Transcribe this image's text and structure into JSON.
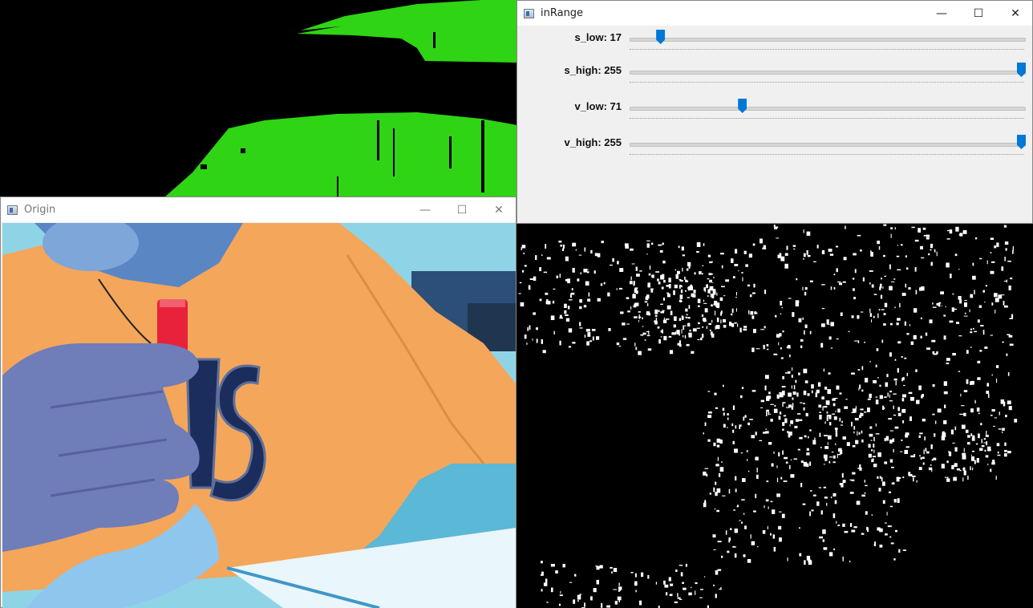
{
  "origin_window": {
    "title": "Origin",
    "minimize": "—",
    "maximize": "☐",
    "close": "✕"
  },
  "inrange_window": {
    "title": "inRange",
    "minimize": "—",
    "maximize": "☐",
    "close": "✕",
    "trackbars": [
      {
        "label": "s_low: 17",
        "value": 17,
        "max": 255
      },
      {
        "label": "s_high: 255",
        "value": 255,
        "max": 255
      },
      {
        "label": "v_low: 71",
        "value": 71,
        "max": 255
      },
      {
        "label": "v_high: 255",
        "value": 255,
        "max": 255
      }
    ]
  },
  "colors": {
    "mask_green": "#2fd414",
    "thumb_blue": "#0078d7",
    "shirt_orange": "#f4a65a"
  }
}
